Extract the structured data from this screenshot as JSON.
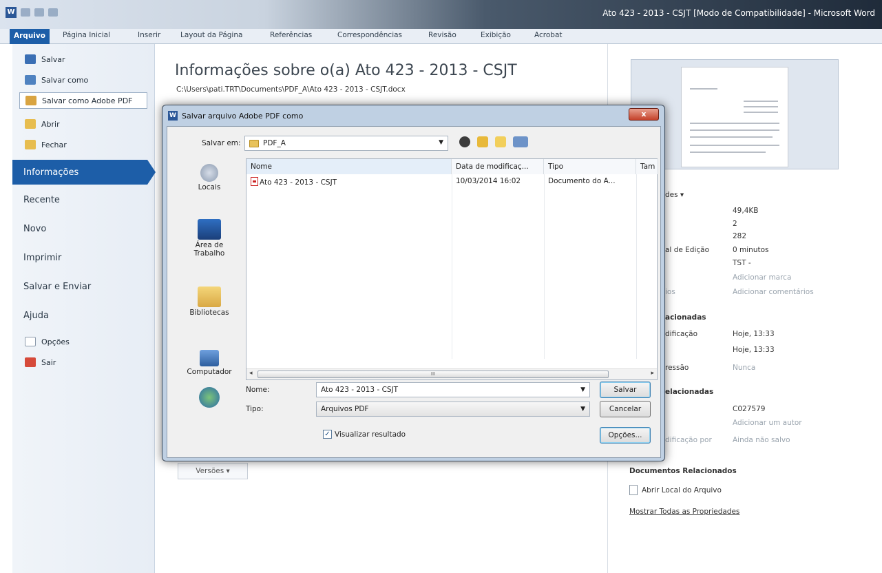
{
  "window": {
    "title": "Ato 423 - 2013 - CSJT [Modo de Compatibilidade] - Microsoft Word",
    "app_icon": "W"
  },
  "ribbon_tabs": [
    {
      "label": "Arquivo",
      "active": true
    },
    {
      "label": "Página Inicial"
    },
    {
      "label": "Inserir"
    },
    {
      "label": "Layout da Página"
    },
    {
      "label": "Referências"
    },
    {
      "label": "Correspondências"
    },
    {
      "label": "Revisão"
    },
    {
      "label": "Exibição"
    },
    {
      "label": "Acrobat"
    }
  ],
  "backstage": {
    "commands": [
      {
        "label": "Salvar",
        "icon": "save-icon"
      },
      {
        "label": "Salvar como",
        "icon": "save-as-icon"
      },
      {
        "label": "Salvar como Adobe PDF",
        "icon": "pdf-save-icon"
      },
      {
        "label": "Abrir",
        "icon": "open-folder-icon"
      },
      {
        "label": "Fechar",
        "icon": "close-folder-icon"
      }
    ],
    "tabs": [
      {
        "label": "Informações",
        "selected": true
      },
      {
        "label": "Recente"
      },
      {
        "label": "Novo"
      },
      {
        "label": "Imprimir"
      },
      {
        "label": "Salvar e Enviar"
      },
      {
        "label": "Ajuda"
      }
    ],
    "footer": [
      {
        "label": "Opções",
        "icon": "options-icon"
      },
      {
        "label": "Sair",
        "icon": "exit-icon"
      }
    ]
  },
  "info": {
    "title": "Informações sobre o(a) Ato 423 - 2013 - CSJT",
    "path": "C:\\Users\\pati.TRT\\Documents\\PDF_A\\Ato 423 - 2013 - CSJT.docx",
    "versions_button": "Versões ▾"
  },
  "properties": {
    "header_fragment": "des ▾",
    "values": [
      "49,4KB",
      "2",
      "282",
      "0 minutos",
      "TST -",
      "Adicionar marca",
      "Adicionar comentários"
    ],
    "label_edit_time": "al de Edição",
    "label_comments": "ios",
    "related_dates_head": "acionadas",
    "label_modified": "dificação",
    "modified_value": "Hoje, 13:33",
    "created_value": "Hoje, 13:33",
    "label_printed": "ressão",
    "printed_value": "Nunca",
    "related_people_head": "elacionadas",
    "author": "C027579",
    "add_author": "Adicionar um autor",
    "label_last_mod_by": "dificação por",
    "last_mod_by_value": "Ainda não salvo",
    "related_docs_head": "Documentos Relacionados",
    "open_location": "Abrir Local do Arquivo",
    "show_all": "Mostrar Todas as Propriedades"
  },
  "dialog": {
    "title": "Salvar arquivo Adobe PDF como",
    "close_label": "x",
    "save_in_label": "Salvar em:",
    "save_in_value": "PDF_A",
    "places": [
      "Locais",
      "Área de\nTrabalho",
      "Bibliotecas",
      "Computador",
      ""
    ],
    "columns": [
      "Nome",
      "Data de modificaç...",
      "Tipo",
      "Tam"
    ],
    "files": [
      {
        "name": "Ato 423 - 2013 - CSJT",
        "date": "10/03/2014 16:02",
        "type": "Documento do A..."
      }
    ],
    "scroll_grip": "III",
    "name_label": "Nome:",
    "name_value": "Ato 423 - 2013 - CSJT",
    "type_label": "Tipo:",
    "type_value": "Arquivos PDF",
    "checkbox_label": "Visualizar resultado",
    "checkbox_checked": true,
    "save_button": "Salvar",
    "cancel_button": "Cancelar",
    "options_button": "Opções..."
  },
  "colors": {
    "backstage_accent": "#1d5ea8",
    "dialog_frame": "#bfd0e3",
    "close_button": "#c4412a"
  }
}
